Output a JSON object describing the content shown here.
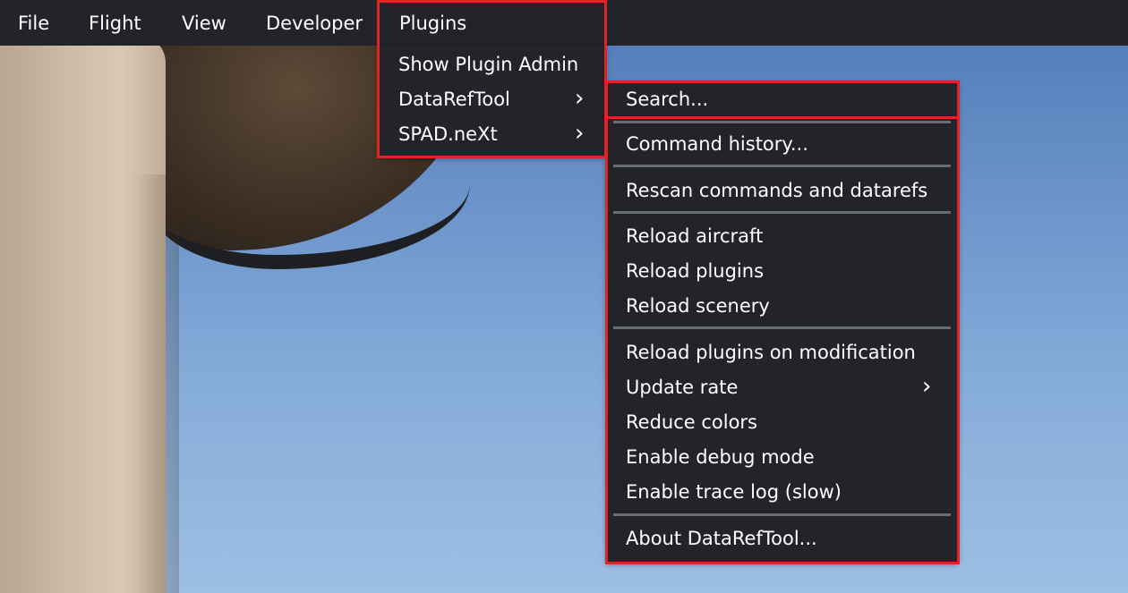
{
  "menubar": {
    "items": [
      {
        "label": "File"
      },
      {
        "label": "Flight"
      },
      {
        "label": "View"
      },
      {
        "label": "Developer"
      },
      {
        "label": "Plugins"
      }
    ]
  },
  "plugins_menu": {
    "items": [
      {
        "label": "Show Plugin Admin",
        "has_submenu": false
      },
      {
        "label": "DataRefTool",
        "has_submenu": true
      },
      {
        "label": "SPAD.neXt",
        "has_submenu": true
      }
    ]
  },
  "dataref_submenu": {
    "groups": [
      [
        "Search..."
      ],
      [
        "Command history..."
      ],
      [
        "Rescan commands and datarefs"
      ],
      [
        "Reload aircraft",
        "Reload plugins",
        "Reload scenery"
      ],
      [
        "Reload plugins on modification",
        "Update rate",
        "Reduce colors",
        "Enable debug mode",
        "Enable trace log (slow)"
      ],
      [
        "About DataRefTool..."
      ]
    ],
    "search": "Search...",
    "command_history": "Command history...",
    "rescan": "Rescan commands and datarefs",
    "reload_aircraft": "Reload aircraft",
    "reload_plugins": "Reload plugins",
    "reload_scenery": "Reload scenery",
    "reload_on_modification": "Reload plugins on modification",
    "update_rate": "Update rate",
    "reduce_colors": "Reduce colors",
    "enable_debug": "Enable debug mode",
    "enable_trace": "Enable trace log (slow)",
    "about": "About DataRefTool..."
  },
  "icons": {
    "submenu_arrow": "chevron-right-icon",
    "submenu_arrow_glyph": "›"
  },
  "colors": {
    "menu_bg": "#222429",
    "highlight_outline": "#e02424",
    "separator": "#6a6d74",
    "text": "#ffffff"
  }
}
